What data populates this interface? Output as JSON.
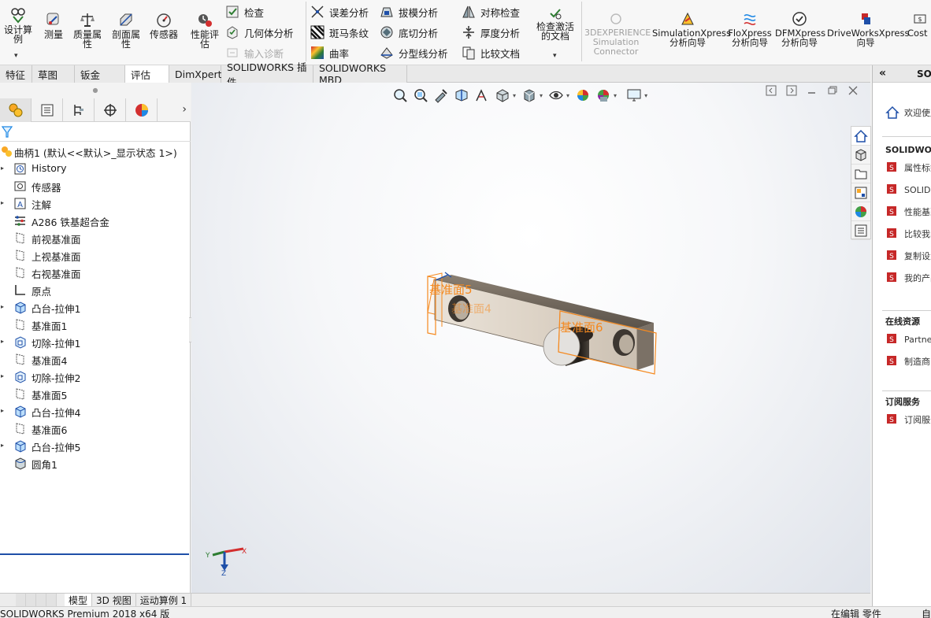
{
  "ribbon": {
    "big_buttons": [
      {
        "label": "设计算例",
        "icon": "design-study-icon"
      },
      {
        "label": "测量",
        "icon": "measure-icon"
      },
      {
        "label": "质量属性",
        "icon": "mass-properties-icon"
      },
      {
        "label": "剖面属性",
        "icon": "section-properties-icon"
      },
      {
        "label": "传感器",
        "icon": "sensor-icon"
      },
      {
        "label": "性能评估",
        "icon": "performance-evaluation-icon"
      }
    ],
    "col1": [
      {
        "label": "检查",
        "icon": "check-icon",
        "disabled": false
      },
      {
        "label": "几何体分析",
        "icon": "geometry-analysis-icon",
        "disabled": false
      },
      {
        "label": "输入诊断",
        "icon": "import-diagnostics-icon",
        "disabled": true
      }
    ],
    "col2": [
      {
        "label": "误差分析",
        "icon": "deviation-analysis-icon"
      },
      {
        "label": "斑马条纹",
        "icon": "zebra-stripes-icon"
      },
      {
        "label": "曲率",
        "icon": "curvature-icon"
      }
    ],
    "col3": [
      {
        "label": "拔模分析",
        "icon": "draft-analysis-icon"
      },
      {
        "label": "底切分析",
        "icon": "undercut-analysis-icon"
      },
      {
        "label": "分型线分析",
        "icon": "parting-line-analysis-icon"
      }
    ],
    "col4": [
      {
        "label": "对称检查",
        "icon": "symmetry-check-icon"
      },
      {
        "label": "厚度分析",
        "icon": "thickness-analysis-icon"
      },
      {
        "label": "比较文档",
        "icon": "compare-documents-icon"
      }
    ],
    "check_active_doc": "检查激活的文档",
    "addins": [
      {
        "label": "3DEXPERIENCE Simulation Connector",
        "icon": "3dexperience-icon",
        "disabled": true
      },
      {
        "label": "SimulationXpress 分析向导",
        "icon": "simulationxpress-icon",
        "disabled": false
      },
      {
        "label": "FloXpress 分析向导",
        "icon": "floxpress-icon",
        "disabled": false
      },
      {
        "label": "DFMXpress 分析向导",
        "icon": "dfmxpress-icon",
        "disabled": false
      },
      {
        "label": "DriveWorksXpress 向导",
        "icon": "driveworksxpress-icon",
        "disabled": false
      },
      {
        "label": "Cost",
        "icon": "costing-icon",
        "disabled": false
      }
    ]
  },
  "command_tabs": [
    "特征",
    "草图",
    "钣金",
    "评估",
    "DimXpert",
    "SOLIDWORKS 插件",
    "SOLIDWORKS MBD"
  ],
  "active_tab": "评估",
  "feature_tree": {
    "root_label": "曲柄1 (默认<<默认>_显示状态 1>)",
    "nodes": [
      {
        "label": "History",
        "icon": "history-icon",
        "expandable": true
      },
      {
        "label": "传感器",
        "icon": "sensor-folder-icon",
        "expandable": false
      },
      {
        "label": "注解",
        "icon": "annotation-icon",
        "expandable": true
      },
      {
        "label": "A286 铁基超合金",
        "icon": "material-icon",
        "expandable": false
      },
      {
        "label": "前视基准面",
        "icon": "plane-icon",
        "expandable": false
      },
      {
        "label": "上视基准面",
        "icon": "plane-icon",
        "expandable": false
      },
      {
        "label": "右视基准面",
        "icon": "plane-icon",
        "expandable": false
      },
      {
        "label": "原点",
        "icon": "origin-icon",
        "expandable": false
      },
      {
        "label": "凸台-拉伸1",
        "icon": "boss-extrude-icon",
        "expandable": true
      },
      {
        "label": "基准面1",
        "icon": "plane-icon",
        "expandable": false
      },
      {
        "label": "切除-拉伸1",
        "icon": "cut-extrude-icon",
        "expandable": true
      },
      {
        "label": "基准面4",
        "icon": "plane-icon",
        "expandable": false
      },
      {
        "label": "切除-拉伸2",
        "icon": "cut-extrude-icon",
        "expandable": true
      },
      {
        "label": "基准面5",
        "icon": "plane-icon",
        "expandable": false
      },
      {
        "label": "凸台-拉伸4",
        "icon": "boss-extrude-icon",
        "expandable": true
      },
      {
        "label": "基准面6",
        "icon": "plane-icon",
        "expandable": false
      },
      {
        "label": "凸台-拉伸5",
        "icon": "boss-extrude-icon",
        "expandable": true
      },
      {
        "label": "圆角1",
        "icon": "fillet-icon",
        "expandable": false
      }
    ]
  },
  "viewport": {
    "plane_labels": [
      "基准面5",
      "基准面4",
      "基准面6"
    ],
    "triad": {
      "x": "X",
      "y": "Y",
      "z": "Z"
    }
  },
  "bottom_tabs": [
    "模型",
    "3D 视图",
    "运动算例 1"
  ],
  "active_bottom_tab": "模型",
  "status": {
    "left": "SOLIDWORKS Premium 2018 x64 版",
    "mid": "在编辑 零件",
    "right": "自"
  },
  "taskpane": {
    "title": "SO",
    "welcome": "欢迎使用",
    "section1": "SOLIDWORKS",
    "items1": [
      "属性标签",
      "SOLIDWORKS",
      "性能基准",
      "比较我的",
      "复制设置",
      "我的产品"
    ],
    "section2": "在线资源",
    "items2": [
      "Partner",
      "制造商"
    ],
    "section3": "订阅服务",
    "items3": [
      "订阅服务"
    ]
  },
  "colors": {
    "accent": "#1e4fa8",
    "plane": "#f5891f",
    "part": "#c9bfb2"
  }
}
